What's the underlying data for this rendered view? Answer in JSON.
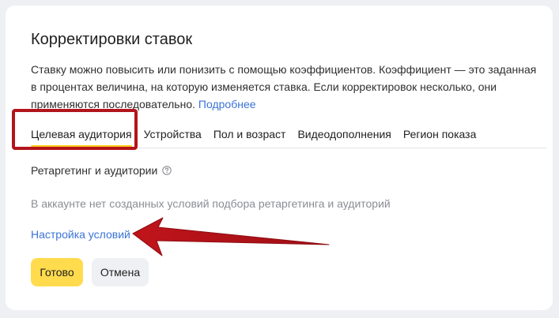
{
  "dialog": {
    "title": "Корректировки ставок",
    "description": "Ставку можно повысить или понизить с помощью коэффициентов. Коэффициент — это заданная в процентах величина, на которую изменяется ставка. Если корректировок несколько, они применяются последовательно.",
    "more_link": "Подробнее"
  },
  "tabs": [
    {
      "label": "Целевая аудитория",
      "active": true
    },
    {
      "label": "Устройства",
      "active": false
    },
    {
      "label": "Пол и возраст",
      "active": false
    },
    {
      "label": "Видеодополнения",
      "active": false
    },
    {
      "label": "Регион показа",
      "active": false
    }
  ],
  "section": {
    "label": "Ретаргетинг и аудитории",
    "help_icon": "question-circle-icon",
    "empty_text": "В аккаунте нет созданных условий подбора ретаргетинга и аудиторий",
    "setup_link": "Настройка условий"
  },
  "buttons": {
    "done": "Готово",
    "cancel": "Отмена"
  },
  "colors": {
    "accent_yellow": "#ffdb4d",
    "tab_underline": "#ffcf1a",
    "link": "#3a73d6",
    "annotation_red": "#b3141b"
  }
}
